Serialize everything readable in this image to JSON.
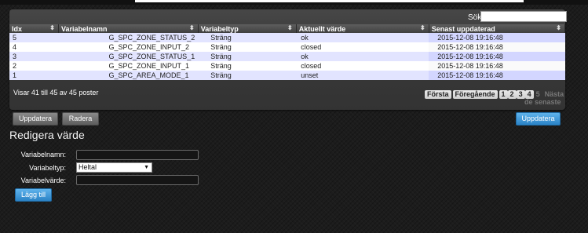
{
  "search": {
    "label": "Sök :",
    "value": ""
  },
  "table": {
    "columns": [
      "Idx",
      "Variabelnamn",
      "Variabeltyp",
      "Aktuellt värde",
      "Senast uppdaterad"
    ],
    "rows": [
      [
        "5",
        "G_SPC_ZONE_STATUS_2",
        "Sträng",
        "ok",
        "2015-12-08 19:16:48"
      ],
      [
        "4",
        "G_SPC_ZONE_INPUT_2",
        "Sträng",
        "closed",
        "2015-12-08 19:16:48"
      ],
      [
        "3",
        "G_SPC_ZONE_STATUS_1",
        "Sträng",
        "ok",
        "2015-12-08 19:16:48"
      ],
      [
        "2",
        "G_SPC_ZONE_INPUT_1",
        "Sträng",
        "closed",
        "2015-12-08 19:16:48"
      ],
      [
        "1",
        "G_SPC_AREA_MODE_1",
        "Sträng",
        "unset",
        "2015-12-08 19:16:48"
      ]
    ]
  },
  "info": "Visar 41 till 45 av 45 poster",
  "pager": {
    "first": "Första",
    "prev": "Föregående",
    "pages": [
      "1",
      "2",
      "3",
      "4",
      "5"
    ],
    "next": "Nästa",
    "last": "de senaste"
  },
  "buttons": {
    "update_left": "Uppdatera",
    "delete": "Radera",
    "update_right": "Uppdatera",
    "add": "Lägg till"
  },
  "edit": {
    "title": "Redigera värde",
    "name_label": "Variabelnamn:",
    "name_value": "",
    "type_label": "Variabeltyp:",
    "type_value": "Heltal",
    "value_label": "Variabelvärde:",
    "value_value": ""
  }
}
